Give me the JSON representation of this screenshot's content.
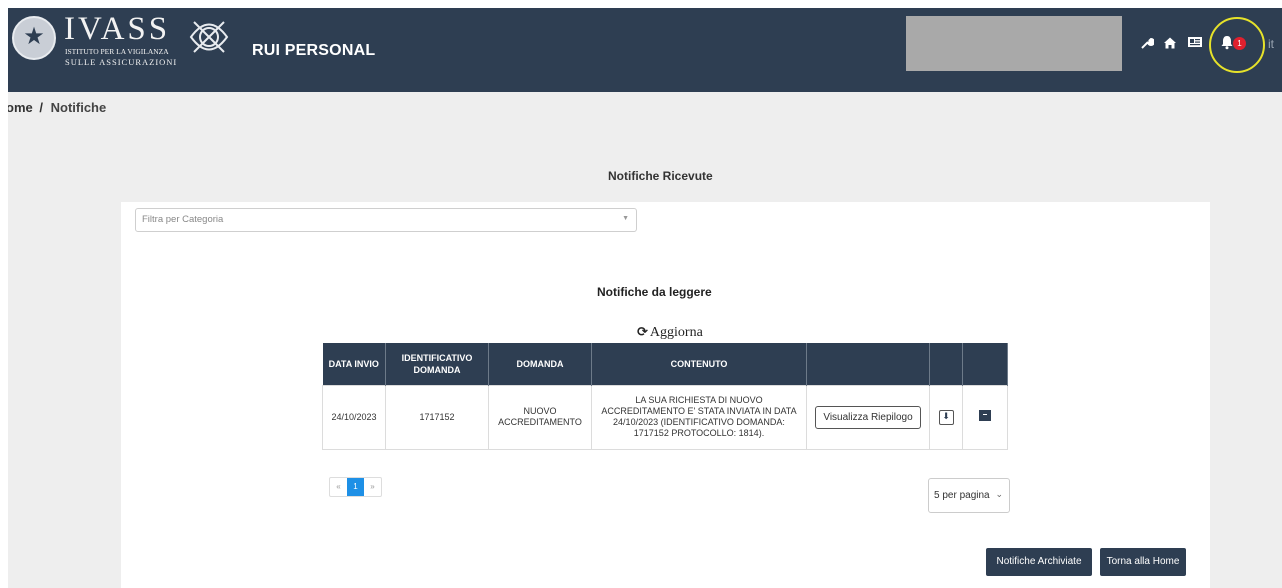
{
  "header": {
    "logo_word": "IVASS",
    "logo_sub1": "ISTITUTO PER LA VIGILANZA",
    "logo_sub2": "SULLE ASSICURAZIONI",
    "app_title": "RUI PERSONAL",
    "icons": [
      "wrench-icon",
      "home-icon",
      "id-card-icon",
      "bell-icon"
    ],
    "notification_count": "1",
    "language": "it"
  },
  "breadcrumb": {
    "home": "ome",
    "separator": "/",
    "current": "Notifiche"
  },
  "page": {
    "section_title": "Notifiche Ricevute",
    "filter_placeholder": "Filtra per Categoria",
    "sub_title": "Notifiche da leggere",
    "refresh_label": "Aggiorna"
  },
  "table": {
    "headers": [
      "DATA INVIO",
      "IDENTIFICATIVO DOMANDA",
      "DOMANDA",
      "CONTENUTO",
      "",
      "",
      ""
    ],
    "rows": [
      {
        "data_invio": "24/10/2023",
        "identificativo": "1717152",
        "domanda": "NUOVO ACCREDITAMENTO",
        "contenuto": "LA SUA RICHIESTA DI NUOVO ACCREDITAMENTO E' STATA INVIATA IN DATA 24/10/2023 (IDENTIFICATIVO DOMANDA: 1717152 PROTOCOLLO: 1814).",
        "button_label": "Visualizza Riepilogo"
      }
    ]
  },
  "pagination": {
    "prev": "«",
    "current": "1",
    "next": "»",
    "per_page": "5 per pagina"
  },
  "actions": {
    "archived": "Notifiche Archiviate",
    "home": "Torna alla Home"
  },
  "colors": {
    "header_bg": "#2e3e52",
    "page_bg": "#eeeeee",
    "badge": "#e0202e",
    "highlight_ring": "#e6e22a",
    "pager_active": "#1e90e6"
  }
}
